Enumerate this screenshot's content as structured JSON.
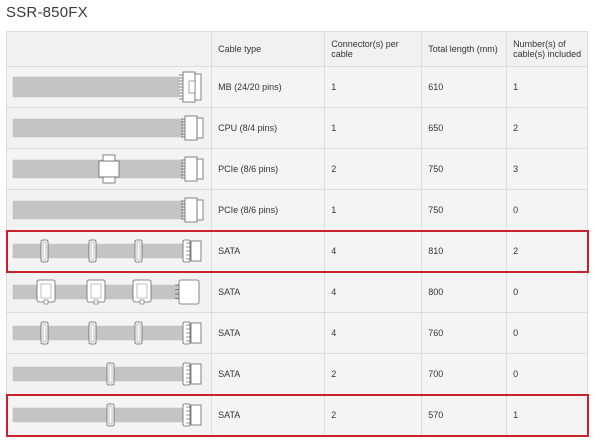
{
  "title": "SSR-850FX",
  "table": {
    "headers": {
      "image": "",
      "cable_type": "Cable type",
      "connectors": "Connector(s) per cable",
      "length": "Total length (mm)",
      "count": "Number(s) of cable(s) included"
    },
    "rows": [
      {
        "image": "mb-cable",
        "cable_type": "MB (24/20 pins)",
        "connectors": "1",
        "length": "610",
        "count": "1",
        "highlighted": false
      },
      {
        "image": "cpu-cable",
        "cable_type": "CPU (8/4 pins)",
        "connectors": "1",
        "length": "650",
        "count": "2",
        "highlighted": false
      },
      {
        "image": "pcie-2-cable",
        "cable_type": "PCIe (8/6 pins)",
        "connectors": "2",
        "length": "750",
        "count": "3",
        "highlighted": false
      },
      {
        "image": "pcie-1-cable",
        "cable_type": "PCIe (8/6 pins)",
        "connectors": "1",
        "length": "750",
        "count": "0",
        "highlighted": false
      },
      {
        "image": "sata-4-cable",
        "cable_type": "SATA",
        "connectors": "4",
        "length": "810",
        "count": "2",
        "highlighted": true
      },
      {
        "image": "peripheral-4-cable",
        "cable_type": "SATA",
        "connectors": "4",
        "length": "800",
        "count": "0",
        "highlighted": false
      },
      {
        "image": "sata-4-cable",
        "cable_type": "SATA",
        "connectors": "4",
        "length": "760",
        "count": "0",
        "highlighted": false
      },
      {
        "image": "sata-2-cable",
        "cable_type": "SATA",
        "connectors": "2",
        "length": "700",
        "count": "0",
        "highlighted": false
      },
      {
        "image": "sata-2-cable",
        "cable_type": "SATA",
        "connectors": "2",
        "length": "570",
        "count": "1",
        "highlighted": true
      }
    ]
  },
  "colors": {
    "highlight": "#c8232c",
    "cable": "#c9c9c9",
    "connector": "#ffffff"
  }
}
